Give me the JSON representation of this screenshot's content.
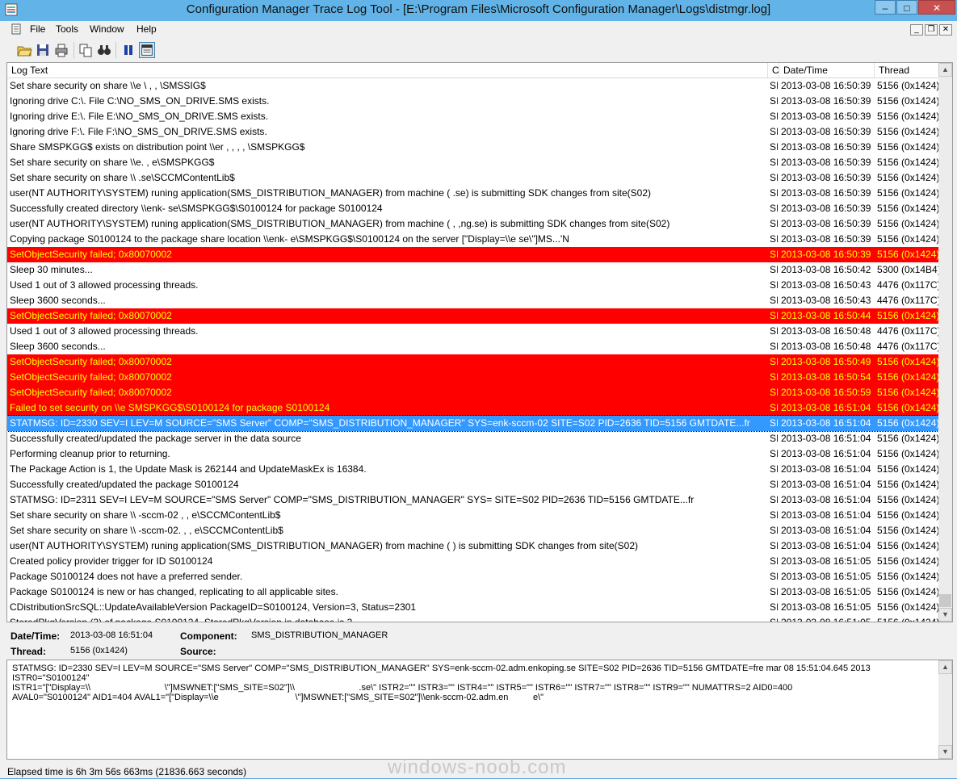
{
  "window": {
    "title": "Configuration Manager Trace Log Tool - [E:\\Program Files\\Microsoft Configuration Manager\\Logs\\distmgr.log]",
    "minimize": "–",
    "maximize": "□",
    "close": "✕"
  },
  "menu": {
    "items": [
      "File",
      "Tools",
      "Window",
      "Help"
    ]
  },
  "mdi": {
    "minimize": "_",
    "restore": "❐",
    "close": "✕"
  },
  "toolbar": {
    "buttons": [
      "open-icon",
      "save-icon",
      "print-icon",
      "copy-icon",
      "find-icon",
      "pause-icon",
      "preview-pane-icon"
    ]
  },
  "columns": {
    "log_text": "Log Text",
    "component": "C",
    "date_time": "Date/Time",
    "thread": "Thread"
  },
  "rows": [
    {
      "text": "Set share security on share \\\\e                    \\                ,     ,        \\SMSSIG$",
      "comp": "SI",
      "date": "2013-03-08 16:50:39",
      "thread": "5156 (0x1424)",
      "kind": "normal"
    },
    {
      "text": "Ignoring drive C:\\.  File C:\\NO_SMS_ON_DRIVE.SMS exists.",
      "comp": "SI",
      "date": "2013-03-08 16:50:39",
      "thread": "5156 (0x1424)",
      "kind": "normal"
    },
    {
      "text": "Ignoring drive E:\\.  File E:\\NO_SMS_ON_DRIVE.SMS exists.",
      "comp": "SI",
      "date": "2013-03-08 16:50:39",
      "thread": "5156 (0x1424)",
      "kind": "normal"
    },
    {
      "text": "Ignoring drive F:\\.  File F:\\NO_SMS_ON_DRIVE.SMS exists.",
      "comp": "SI",
      "date": "2013-03-08 16:50:39",
      "thread": "5156 (0x1424)",
      "kind": "normal"
    },
    {
      "text": "Share SMSPKGG$ exists on distribution point \\\\er                 ,  ,  ,       ,     \\SMSPKGG$",
      "comp": "SI",
      "date": "2013-03-08 16:50:39",
      "thread": "5156 (0x1424)",
      "kind": "normal"
    },
    {
      "text": "Set share security on share \\\\e.                     ,              e\\SMSPKGG$",
      "comp": "SI",
      "date": "2013-03-08 16:50:39",
      "thread": "5156 (0x1424)",
      "kind": "normal"
    },
    {
      "text": "Set share security on share \\\\                          .se\\SCCMContentLib$",
      "comp": "SI",
      "date": "2013-03-08 16:50:39",
      "thread": "5156 (0x1424)",
      "kind": "normal"
    },
    {
      "text": "user(NT AUTHORITY\\SYSTEM) runing application(SMS_DISTRIBUTION_MANAGER) from machine (                         .se) is submitting SDK changes from site(S02)",
      "comp": "SI",
      "date": "2013-03-08 16:50:39",
      "thread": "5156 (0x1424)",
      "kind": "normal"
    },
    {
      "text": "Successfully created directory \\\\enk-                             se\\SMSPKGG$\\S0100124 for package S0100124",
      "comp": "SI",
      "date": "2013-03-08 16:50:39",
      "thread": "5156 (0x1424)",
      "kind": "normal"
    },
    {
      "text": "user(NT AUTHORITY\\SYSTEM) runing application(SMS_DISTRIBUTION_MANAGER) from machine (                          ,  ,ng.se) is submitting SDK changes from site(S02)",
      "comp": "SI",
      "date": "2013-03-08 16:50:39",
      "thread": "5156 (0x1424)",
      "kind": "normal"
    },
    {
      "text": "Copying package S0100124 to the package share location \\\\enk-                         e\\SMSPKGG$\\S0100124 on the server [\"Display=\\\\e                          se\\\"]MS...'N",
      "comp": "SI",
      "date": "2013-03-08 16:50:39",
      "thread": "5156 (0x1424)",
      "kind": "normal"
    },
    {
      "text": "SetObjectSecurity failed; 0x80070002",
      "comp": "SI",
      "date": "2013-03-08 16:50:39",
      "thread": "5156 (0x1424)",
      "kind": "error"
    },
    {
      "text": "Sleep 30 minutes...",
      "comp": "SI",
      "date": "2013-03-08 16:50:42",
      "thread": "5300 (0x14B4)",
      "kind": "normal"
    },
    {
      "text": "Used 1 out of 3 allowed processing threads.",
      "comp": "SI",
      "date": "2013-03-08 16:50:43",
      "thread": "4476 (0x117C)",
      "kind": "normal"
    },
    {
      "text": "Sleep 3600 seconds...",
      "comp": "SI",
      "date": "2013-03-08 16:50:43",
      "thread": "4476 (0x117C)",
      "kind": "normal"
    },
    {
      "text": "SetObjectSecurity failed; 0x80070002",
      "comp": "SI",
      "date": "2013-03-08 16:50:44",
      "thread": "5156 (0x1424)",
      "kind": "error"
    },
    {
      "text": "Used 1 out of 3 allowed processing threads.",
      "comp": "SI",
      "date": "2013-03-08 16:50:48",
      "thread": "4476 (0x117C)",
      "kind": "normal"
    },
    {
      "text": "Sleep 3600 seconds...",
      "comp": "SI",
      "date": "2013-03-08 16:50:48",
      "thread": "4476 (0x117C)",
      "kind": "normal"
    },
    {
      "text": "SetObjectSecurity failed; 0x80070002",
      "comp": "SI",
      "date": "2013-03-08 16:50:49",
      "thread": "5156 (0x1424)",
      "kind": "error"
    },
    {
      "text": "SetObjectSecurity failed; 0x80070002",
      "comp": "SI",
      "date": "2013-03-08 16:50:54",
      "thread": "5156 (0x1424)",
      "kind": "error"
    },
    {
      "text": "SetObjectSecurity failed; 0x80070002",
      "comp": "SI",
      "date": "2013-03-08 16:50:59",
      "thread": "5156 (0x1424)",
      "kind": "error"
    },
    {
      "text": "Failed to set security on \\\\e                                  SMSPKGG$\\S0100124 for package S0100124",
      "comp": "SI",
      "date": "2013-03-08 16:51:04",
      "thread": "5156 (0x1424)",
      "kind": "error"
    },
    {
      "text": "STATMSG: ID=2330 SEV=I LEV=M SOURCE=\"SMS Server\" COMP=\"SMS_DISTRIBUTION_MANAGER\" SYS=enk-sccm-02                     SITE=S02 PID=2636 TID=5156 GMTDATE...fr",
      "comp": "SI",
      "date": "2013-03-08 16:51:04",
      "thread": "5156 (0x1424)",
      "kind": "selected"
    },
    {
      "text": "Successfully created/updated the package server in the data source",
      "comp": "SI",
      "date": "2013-03-08 16:51:04",
      "thread": "5156 (0x1424)",
      "kind": "normal"
    },
    {
      "text": "Performing cleanup prior to returning.",
      "comp": "SI",
      "date": "2013-03-08 16:51:04",
      "thread": "5156 (0x1424)",
      "kind": "normal"
    },
    {
      "text": "The Package Action is 1, the Update Mask is 262144 and UpdateMaskEx is 16384.",
      "comp": "SI",
      "date": "2013-03-08 16:51:04",
      "thread": "5156 (0x1424)",
      "kind": "normal"
    },
    {
      "text": "Successfully created/updated the package S0100124",
      "comp": "SI",
      "date": "2013-03-08 16:51:04",
      "thread": "5156 (0x1424)",
      "kind": "normal"
    },
    {
      "text": "STATMSG: ID=2311 SEV=I LEV=M SOURCE=\"SMS Server\" COMP=\"SMS_DISTRIBUTION_MANAGER\" SYS=                            SITE=S02 PID=2636 TID=5156 GMTDATE...fr",
      "comp": "SI",
      "date": "2013-03-08 16:51:04",
      "thread": "5156 (0x1424)",
      "kind": "normal"
    },
    {
      "text": "Set share security on share \\\\      -sccm-02       ,     ,      e\\SCCMContentLib$",
      "comp": "SI",
      "date": "2013-03-08 16:51:04",
      "thread": "5156 (0x1424)",
      "kind": "normal"
    },
    {
      "text": "Set share security on share \\\\      -sccm-02.       ,      ,  e\\SCCMContentLib$",
      "comp": "SI",
      "date": "2013-03-08 16:51:04",
      "thread": "5156 (0x1424)",
      "kind": "normal"
    },
    {
      "text": "user(NT AUTHORITY\\SYSTEM) runing application(SMS_DISTRIBUTION_MANAGER) from machine (                               ) is submitting SDK changes from site(S02)",
      "comp": "SI",
      "date": "2013-03-08 16:51:04",
      "thread": "5156 (0x1424)",
      "kind": "normal"
    },
    {
      "text": "Created policy provider trigger for ID S0100124",
      "comp": "SI",
      "date": "2013-03-08 16:51:05",
      "thread": "5156 (0x1424)",
      "kind": "normal"
    },
    {
      "text": "Package S0100124 does not have a preferred sender.",
      "comp": "SI",
      "date": "2013-03-08 16:51:05",
      "thread": "5156 (0x1424)",
      "kind": "normal"
    },
    {
      "text": "Package S0100124 is new or has changed, replicating to all applicable sites.",
      "comp": "SI",
      "date": "2013-03-08 16:51:05",
      "thread": "5156 (0x1424)",
      "kind": "normal"
    },
    {
      "text": "CDistributionSrcSQL::UpdateAvailableVersion PackageID=S0100124, Version=3, Status=2301",
      "comp": "SI",
      "date": "2013-03-08 16:51:05",
      "thread": "5156 (0x1424)",
      "kind": "normal"
    },
    {
      "text": "StoredPkgVersion (3) of package S0100124. StoredPkgVersion in database is 3.",
      "comp": "SI",
      "date": "2013-03-08 16:51:05",
      "thread": "5156 (0x1424)",
      "kind": "normal"
    }
  ],
  "details": {
    "date_time_label": "Date/Time:",
    "date_time_value": "2013-03-08 16:51:04",
    "component_label": "Component:",
    "component_value": "SMS_DISTRIBUTION_MANAGER",
    "thread_label": "Thread:",
    "thread_value": "5156 (0x1424)",
    "source_label": "Source:",
    "source_value": ""
  },
  "message": "STATMSG: ID=2330 SEV=I LEV=M SOURCE=\"SMS Server\" COMP=\"SMS_DISTRIBUTION_MANAGER\" SYS=enk-sccm-02.adm.enkoping.se SITE=S02 PID=2636 TID=5156 GMTDATE=fre mar 08 15:51:04.645 2013 ISTR0=\"S0100124\"\nISTR1=\"[\"Display=\\\\                              \\\"]MSWNET:[\"SMS_SITE=S02\"]\\\\                          .se\\\" ISTR2=\"\" ISTR3=\"\" ISTR4=\"\" ISTR5=\"\" ISTR6=\"\" ISTR7=\"\" ISTR8=\"\" ISTR9=\"\" NUMATTRS=2 AID0=400\nAVAL0=\"S0100124\" AID1=404 AVAL1=\"[\"Display=\\\\e                               \\\"]MSWNET:[\"SMS_SITE=S02\"]\\\\enk-sccm-02.adm.en          e\\\"",
  "status": "Elapsed time is 6h 3m 56s 663ms (21836.663 seconds)",
  "watermark": "windows-noob.com",
  "colors": {
    "error_bg": "#ff0000",
    "error_text": "#ffff00",
    "selected_bg": "#3399ff",
    "titlebar": "#62b4e8"
  }
}
